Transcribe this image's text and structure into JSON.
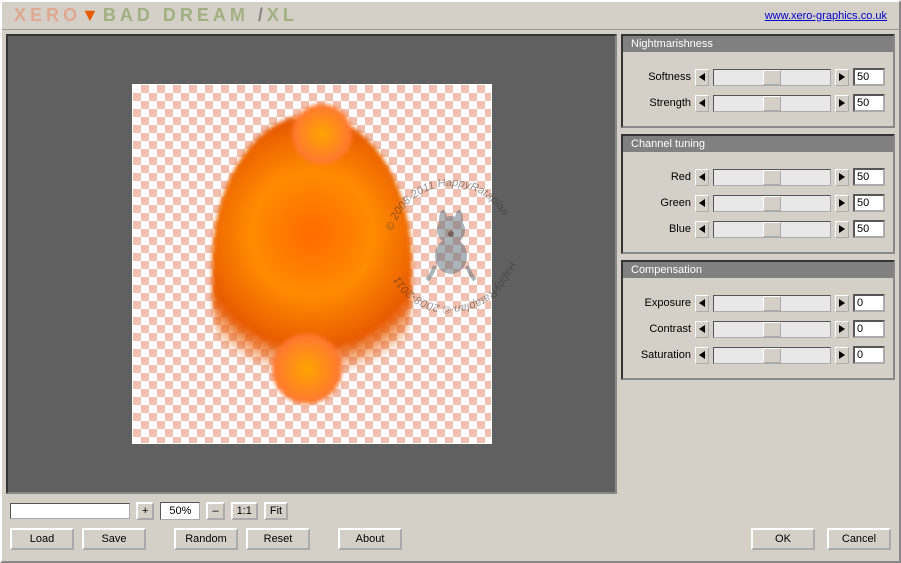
{
  "title": {
    "xero": "XERO",
    "arrow": "▼",
    "bad": "BAD DREAM ",
    "slash": "/",
    "xl": "XL"
  },
  "url": "www.xero-graphics.co.uk",
  "watermark": {
    "text_top": "© 2008-2011  HappyRataplan",
    "text_bottom": "HappyRataplan  © 2008-2011"
  },
  "groups": {
    "nightmarishness": {
      "title": "Nightmarishness",
      "softness": {
        "label": "Softness",
        "value": "50"
      },
      "strength": {
        "label": "Strength",
        "value": "50"
      }
    },
    "channel": {
      "title": "Channel tuning",
      "red": {
        "label": "Red",
        "value": "50"
      },
      "green": {
        "label": "Green",
        "value": "50"
      },
      "blue": {
        "label": "Blue",
        "value": "50"
      }
    },
    "compensation": {
      "title": "Compensation",
      "exposure": {
        "label": "Exposure",
        "value": "0"
      },
      "contrast": {
        "label": "Contrast",
        "value": "0"
      },
      "saturation": {
        "label": "Saturation",
        "value": "0"
      }
    }
  },
  "zoom": {
    "plus": "+",
    "value": "50%",
    "minus": "–",
    "one_to_one": "1:1",
    "fit": "Fit"
  },
  "buttons": {
    "load": "Load",
    "save": "Save",
    "random": "Random",
    "reset": "Reset",
    "about": "About",
    "ok": "OK",
    "cancel": "Cancel"
  }
}
